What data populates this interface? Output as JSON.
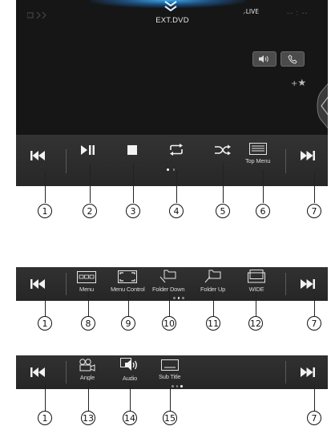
{
  "header": {
    "source": "EXT.DVD",
    "live_label": "LIVE",
    "clock": "-- : --"
  },
  "main_controls": {
    "top_menu_label": "Top Menu"
  },
  "strip2": {
    "menu_label": "Menu",
    "menu_control_label": "Menu Control",
    "folder_down_label": "Folder Down",
    "folder_up_label": "Folder Up",
    "wide_label": "WIDE"
  },
  "strip3": {
    "angle_label": "Angle",
    "audio_label": "Audio",
    "subtitle_label": "Sub Title"
  },
  "callouts": {
    "c1": "1",
    "c2": "2",
    "c3": "3",
    "c4": "4",
    "c5": "5",
    "c6": "6",
    "c7": "7",
    "c8": "8",
    "c9": "9",
    "c10": "10",
    "c11": "11",
    "c12": "12",
    "c13": "13",
    "c14": "14",
    "c15": "15"
  },
  "page_indicator": {
    "pages": 3
  },
  "colors": {
    "accent_glow": "#3fa8e8",
    "screen_bg": "#161616",
    "control_bar": "#2e2e2e"
  }
}
